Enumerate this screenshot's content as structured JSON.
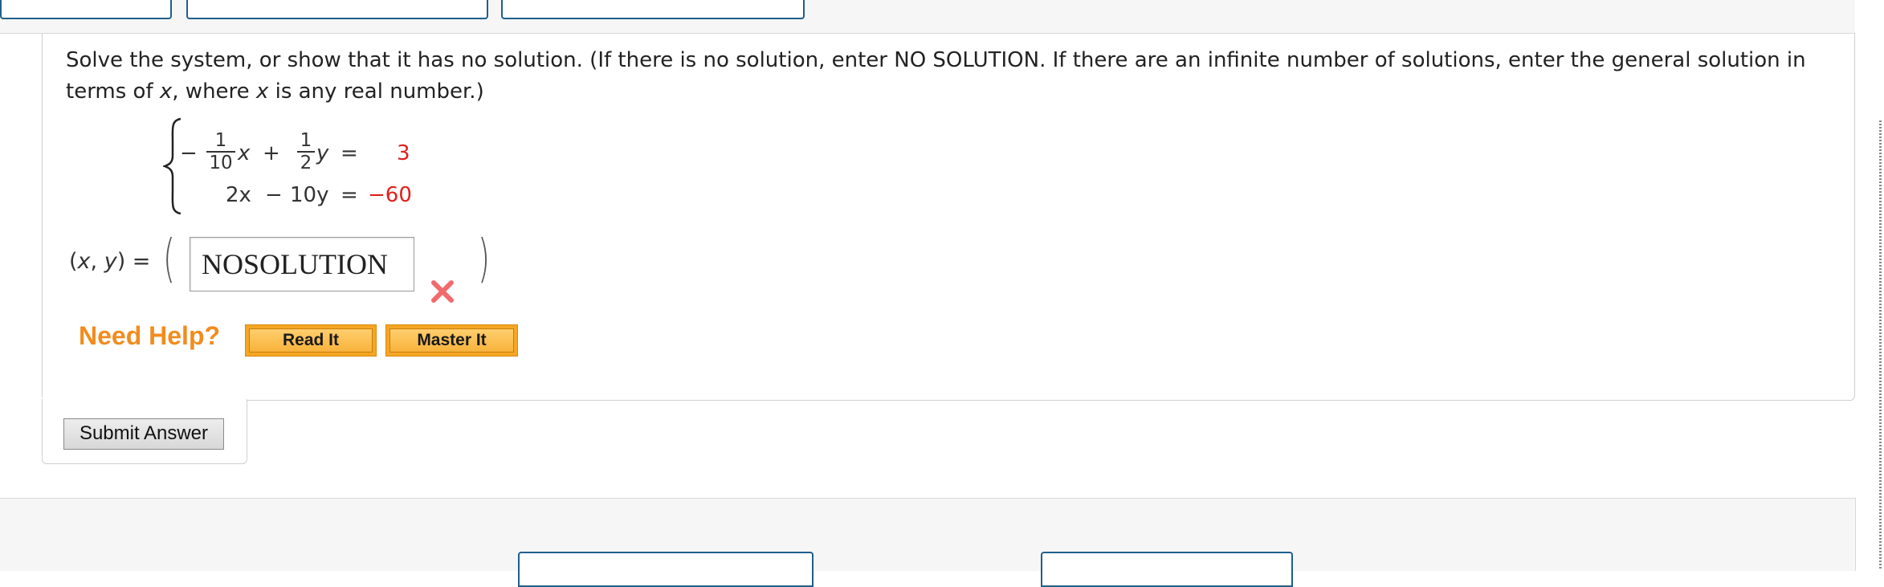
{
  "question": {
    "prompt_part1": "Solve the system, or show that it has no solution. (If there is no solution, enter NO SOLUTION. If there are an infinite number of solutions, enter the general solution in terms of ",
    "prompt_var1": "x",
    "prompt_part2": ", where ",
    "prompt_var2": "x",
    "prompt_part3": " is any real number.)"
  },
  "system": {
    "eq1": {
      "minus": "−",
      "coef_x_num": "1",
      "coef_x_den": "10",
      "var_x": "x",
      "plus": "+",
      "coef_y_num": "1",
      "coef_y_den": "2",
      "var_y": "y",
      "equals": "=",
      "rhs": "3"
    },
    "eq2": {
      "term_x": "2x",
      "minus": "−",
      "term_y": "10y",
      "equals": "=",
      "rhs": "−60"
    }
  },
  "answer": {
    "label_prefix": "(",
    "var_x": "x",
    "sep": ", ",
    "var_y": "y",
    "label_suffix": ") =",
    "value": "NOSOLUTION",
    "status": "incorrect",
    "status_icon": "cross-icon"
  },
  "help": {
    "label": "Need Help?",
    "read_it": "Read It",
    "master_it": "Master It"
  },
  "submit": {
    "label": "Submit Answer"
  },
  "colors": {
    "help_orange": "#f28c1e",
    "rhs_red": "#e0201b",
    "incorrect_red": "#f26b6b",
    "nav_blue": "#1f5f8b"
  }
}
